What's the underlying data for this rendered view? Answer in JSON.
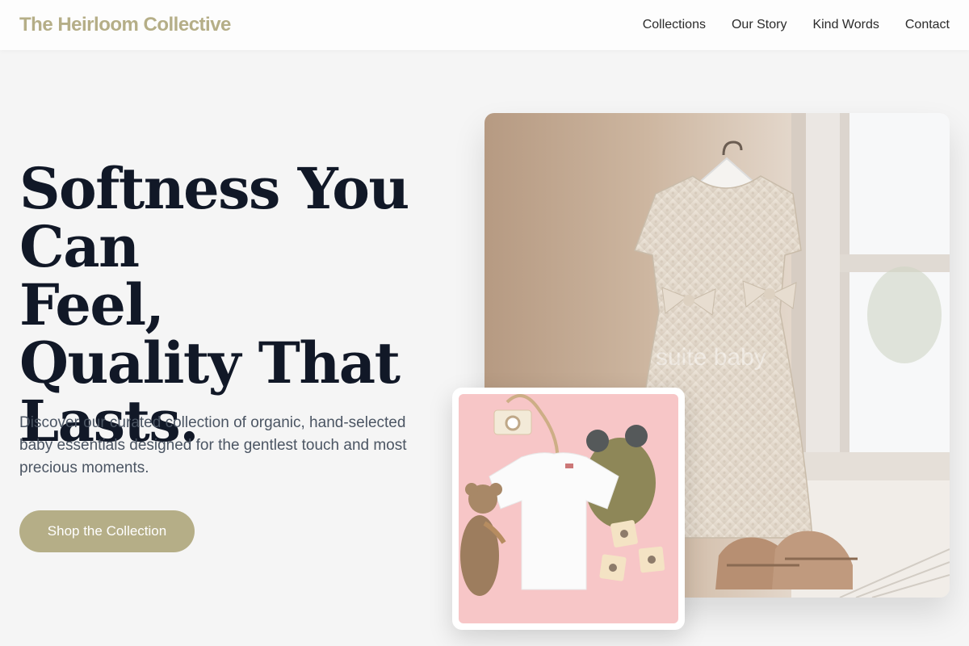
{
  "brand": {
    "name": "The Heirloom Collective"
  },
  "nav": {
    "links": [
      {
        "label": "Collections"
      },
      {
        "label": "Our Story"
      },
      {
        "label": "Kind Words"
      },
      {
        "label": "Contact"
      }
    ]
  },
  "hero": {
    "title_lines": [
      "Softness You Can",
      "Feel,",
      "Quality That",
      "Lasts."
    ],
    "description": "Discover our curated collection of organic, hand-selected baby essentials designed for the gentlest touch and most precious moments.",
    "cta_label": "Shop the Collection"
  },
  "images": {
    "main_watermark": "suite baby"
  },
  "colors": {
    "accent": "#b5ae87",
    "heading": "#111827",
    "body_text": "#4b5563",
    "background": "#f5f5f5",
    "inset_bg": "#f7c6c7"
  }
}
